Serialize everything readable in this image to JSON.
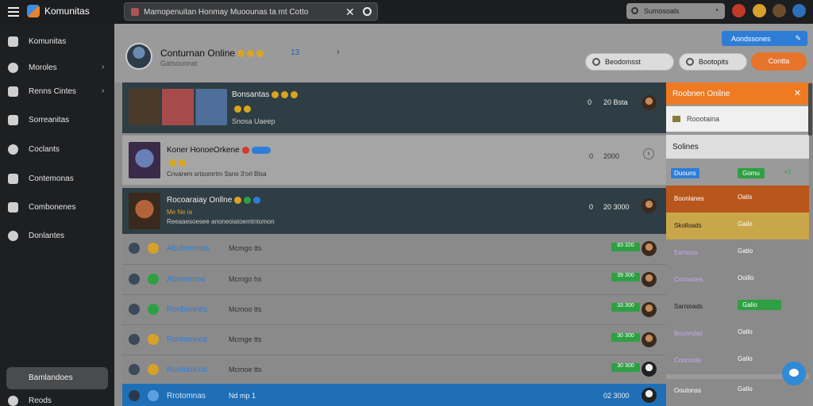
{
  "app": {
    "title": "Komunitas"
  },
  "search": {
    "value": "Mamopenuitan Honmay Muoounas ta mt Cotto"
  },
  "topbar": {
    "user_box_label": "Sumosoals"
  },
  "sidebar": {
    "items": [
      {
        "label": "Komunitas"
      },
      {
        "label": "Moroles"
      },
      {
        "label": "Renns Cintes"
      },
      {
        "label": "Sorreanitas"
      },
      {
        "label": "Coclants"
      },
      {
        "label": "Contemonas"
      },
      {
        "label": "Combonenes"
      },
      {
        "label": "Donlantes"
      }
    ],
    "bottom_button": "Bamlandoes",
    "bottom_link": "Reods"
  },
  "header": {
    "title": "Conturnan Online",
    "subtitle": "Gatsounnat",
    "count": "13",
    "primary_button": "Aondssones",
    "filter1": "Beodomsst",
    "filter2": "Bootopits",
    "action": "Contta"
  },
  "rows": [
    {
      "title": "Bonsantas",
      "sub": "Snosa Uaeep",
      "meta1": "0",
      "meta2": "20 Bsta"
    },
    {
      "title": "Koner HonoeOrkene",
      "sub": "Cnvarem srtsomrtm Ssno 3'orl Blsa",
      "meta1": "0",
      "meta2": "2000"
    },
    {
      "title": "Rocoaraiay Onllne",
      "sub": "Reeaaesoesee anoneoiatoemtntomon",
      "tag": "Me Ne ia",
      "meta1": "0",
      "meta2": "20 3000"
    }
  ],
  "list": [
    {
      "name": "Abubomnas",
      "mid": "Mcmgo tts",
      "badge": "83 320"
    },
    {
      "name": "Abeerenos",
      "mid": "Mcmgo hs",
      "badge": "39 300"
    },
    {
      "name": "Ronbonnes",
      "mid": "Mcmoo tts",
      "badge": "33 300"
    },
    {
      "name": "Rontomnos",
      "mid": "Mcmge tts",
      "badge": "30 300"
    },
    {
      "name": "Rontomnos",
      "mid": "Mcmoe tts",
      "badge": "30 300"
    },
    {
      "name": "Rrotomnas",
      "mid": "Nd mp 1",
      "badge": "02 3000"
    }
  ],
  "panel": {
    "title": "Roobnen Onilne",
    "search_label": "Roootaina",
    "section": "Solines",
    "rows": [
      {
        "tag": "Duouns",
        "status": "Gomu",
        "extra": "+3"
      },
      {
        "tag": "Boonlanes",
        "status": "Oalis"
      },
      {
        "tag": "Skolloads",
        "status": "Gailo"
      },
      {
        "tag": "Eurnoss",
        "status": "Gatio"
      },
      {
        "tag": "Connorles",
        "status": "Ooillo"
      },
      {
        "tag": "Sarnioads",
        "status": "Galio"
      },
      {
        "tag": "Bounndas",
        "status": "Oallo"
      },
      {
        "tag": "Connnolo",
        "status": "Gallo"
      },
      {
        "tag": "Ooutonss",
        "status": "Gallo"
      }
    ]
  }
}
